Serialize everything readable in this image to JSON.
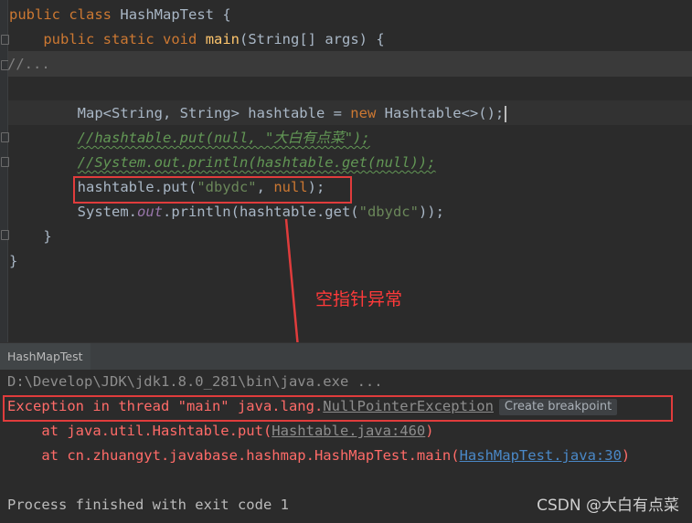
{
  "editor": {
    "lines": {
      "l1": {
        "kw1": "public",
        "kw2": "class",
        "name": "HashMapTest",
        "brace": "{"
      },
      "l2": {
        "kw1": "public",
        "kw2": "static",
        "kw3": "void",
        "fn": "main",
        "rest": "(String[] args) {"
      },
      "l3": {
        "text": "//..."
      },
      "l5": {
        "a": "Map<String, String> hashtable = ",
        "kw": "new",
        "b": " Hashtable<>();"
      },
      "l6": {
        "text": "//hashtable.put(null, \"大白有点菜\");"
      },
      "l7": {
        "text": "//System.out.println(hashtable.get(null));"
      },
      "l8": {
        "a": "hashtable.put(",
        "str": "\"dbydc\"",
        "b": ", ",
        "kw": "null",
        "c": ");"
      },
      "l9": {
        "a": "System.",
        "field": "out",
        "b": ".println(hashtable.get(",
        "str": "\"dbydc\"",
        "c": "));"
      },
      "l10": {
        "text": "}"
      },
      "l11": {
        "text": "}"
      }
    }
  },
  "annotation": {
    "text": "空指针异常",
    "color": "#ff3a3a"
  },
  "run_panel": {
    "tab_label": "HashMapTest"
  },
  "console": {
    "cmd": "D:\\Develop\\JDK\\jdk1.8.0_281\\bin\\java.exe ...",
    "exception_prefix": "Exception in thread \"main\" java.lang.",
    "exception_link": "NullPointerException",
    "create_breakpoint": "Create breakpoint",
    "trace1_prefix": "    at java.util.Hashtable.put(",
    "trace1_link": "Hashtable.java:460",
    "trace1_suffix": ")",
    "trace2_prefix": "    at cn.zhuangyt.javabase.hashmap.HashMapTest.main(",
    "trace2_link": "HashMapTest.java:30",
    "trace2_suffix": ")",
    "exit": "Process finished with exit code 1"
  },
  "watermark": "CSDN @大白有点菜",
  "colors": {
    "keyword": "#cc7832",
    "string": "#6a8759",
    "comment": "#629755",
    "error": "#ff6b68",
    "link": "#4a88c7",
    "box": "#e03c3c"
  }
}
